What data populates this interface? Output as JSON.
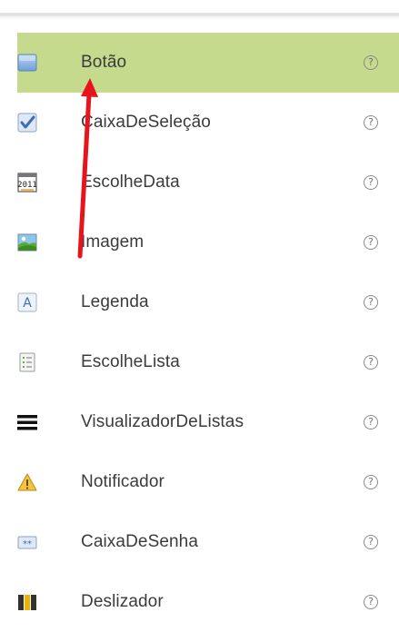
{
  "palette": {
    "items": [
      {
        "label": "Botão",
        "icon": "button-icon",
        "selected": true,
        "help": "?"
      },
      {
        "label": "CaixaDeSeleção",
        "icon": "checkbox-icon",
        "selected": false,
        "help": "?"
      },
      {
        "label": "EscolheData",
        "icon": "calendar-icon",
        "selected": false,
        "help": "?"
      },
      {
        "label": "Imagem",
        "icon": "image-icon",
        "selected": false,
        "help": "?"
      },
      {
        "label": "Legenda",
        "icon": "label-icon",
        "selected": false,
        "help": "?"
      },
      {
        "label": "EscolheLista",
        "icon": "list-picker-icon",
        "selected": false,
        "help": "?"
      },
      {
        "label": "VisualizadorDeListas",
        "icon": "list-view-icon",
        "selected": false,
        "help": "?"
      },
      {
        "label": "Notificador",
        "icon": "warning-icon",
        "selected": false,
        "help": "?"
      },
      {
        "label": "CaixaDeSenha",
        "icon": "password-icon",
        "selected": false,
        "help": "?"
      },
      {
        "label": "Deslizador",
        "icon": "slider-icon",
        "selected": false,
        "help": "?"
      }
    ]
  },
  "colors": {
    "selected_background": "#c6da8e",
    "arrow": "#e8141b"
  }
}
